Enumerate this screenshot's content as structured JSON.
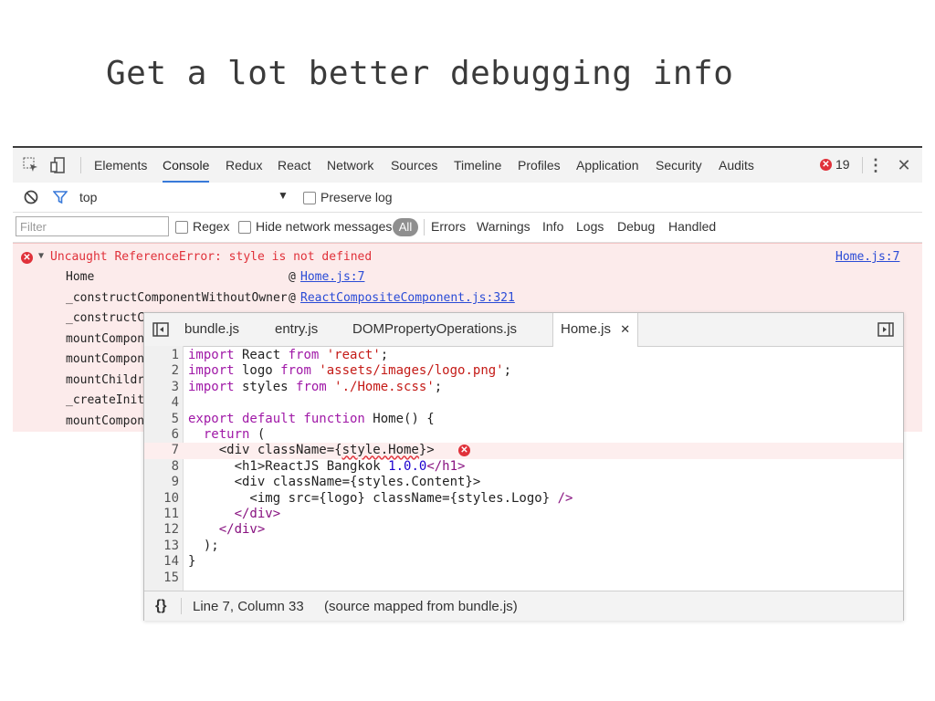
{
  "slide": {
    "title": "Get a lot better debugging info"
  },
  "devtools": {
    "tabs": [
      "Elements",
      "Console",
      "Redux",
      "React",
      "Network",
      "Sources",
      "Timeline",
      "Profiles",
      "Application",
      "Security",
      "Audits"
    ],
    "active_tab": "Console",
    "error_count": "19",
    "context": "top",
    "preserve_log_label": "Preserve log",
    "filter_placeholder": "Filter",
    "regex_label": "Regex",
    "hide_network_label": "Hide network messages",
    "levels": [
      "All",
      "Errors",
      "Warnings",
      "Info",
      "Logs",
      "Debug",
      "Handled"
    ],
    "colors": {
      "accent": "#3879d9",
      "error": "#e0313a",
      "error_bg": "#fcebeb"
    }
  },
  "console": {
    "error_message": "Uncaught ReferenceError: style is not defined",
    "error_source": "Home.js:7",
    "stack": [
      {
        "fn": "Home",
        "src": "Home.js:7"
      },
      {
        "fn": "_constructComponentWithoutOwner",
        "src": "ReactCompositeComponent.js:321"
      },
      {
        "fn": "_constructC",
        "src": ""
      },
      {
        "fn": "mountCompon",
        "src": ""
      },
      {
        "fn": "mountCompon",
        "src": ""
      },
      {
        "fn": "mountChildr",
        "src": ""
      },
      {
        "fn": "_createInit",
        "src": ""
      },
      {
        "fn": "mountCompon",
        "src": ""
      }
    ]
  },
  "sources": {
    "tabs": [
      "bundle.js",
      "entry.js",
      "DOMPropertyOperations.js",
      "Home.js"
    ],
    "active_tab": "Home.js",
    "line_numbers": [
      "1",
      "2",
      "3",
      "4",
      "5",
      "6",
      "7",
      "8",
      "9",
      "10",
      "11",
      "12",
      "13",
      "14",
      "15"
    ],
    "status_text": "Line 7, Column 33",
    "status_note": "(source mapped from bundle.js)",
    "format_icon": "{}"
  }
}
